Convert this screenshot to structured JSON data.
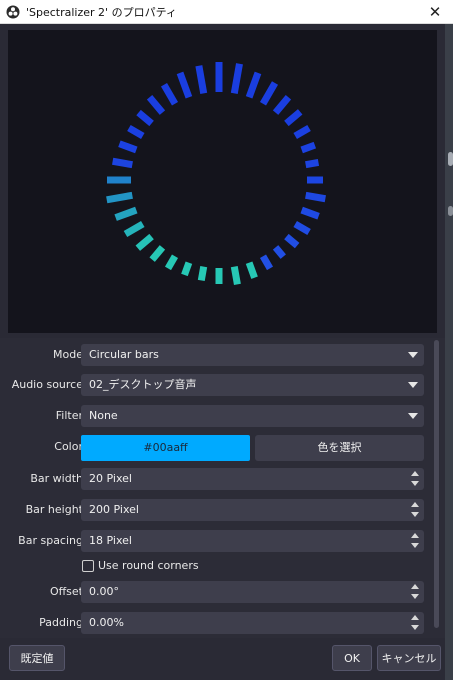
{
  "window": {
    "title": "'Spectralizer 2' のプロパティ",
    "close_glyph": "✕"
  },
  "preview": {
    "visualizer_type": "circular-bars",
    "bar_color_primary": "#1a3ee0",
    "bar_color_secondary": "#27c8b5",
    "background": "#14141c"
  },
  "properties": {
    "mode": {
      "label": "Mode",
      "value": "Circular bars"
    },
    "audio_source": {
      "label": "Audio source",
      "value": "02_デスクトップ音声"
    },
    "filter": {
      "label": "Filter",
      "value": "None"
    },
    "color": {
      "label": "Color",
      "value": "#00aaff",
      "swatch": "#00aaff",
      "select_label": "色を選択"
    },
    "bar_width": {
      "label": "Bar width",
      "value": "20 Pixel"
    },
    "bar_height": {
      "label": "Bar height",
      "value": "200 Pixel"
    },
    "bar_spacing": {
      "label": "Bar spacing",
      "value": "18 Pixel"
    },
    "round_corners": {
      "label": "Use round corners",
      "checked": false
    },
    "offset": {
      "label": "Offset",
      "value": "0.00°"
    },
    "padding": {
      "label": "Padding",
      "value": "0.00%"
    }
  },
  "footer": {
    "defaults_label": "既定値",
    "ok_label": "OK",
    "cancel_label": "キャンセル"
  }
}
